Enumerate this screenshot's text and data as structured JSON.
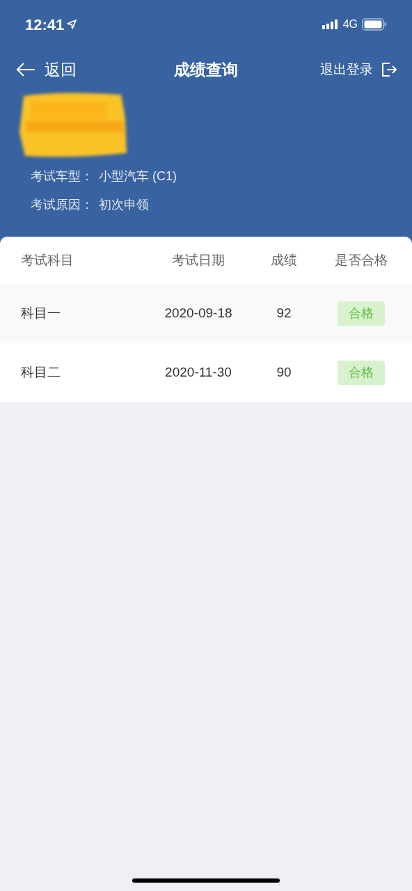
{
  "status_bar": {
    "time": "12:41",
    "network": "4G"
  },
  "nav": {
    "back": "返回",
    "title": "成绩查询",
    "logout": "退出登录"
  },
  "info": [
    {
      "label": "考试车型：",
      "value": "小型汽车 (C1)"
    },
    {
      "label": "考试原因：",
      "value": "初次申领"
    }
  ],
  "table": {
    "columns": [
      "考试科目",
      "考试日期",
      "成绩",
      "是否合格"
    ],
    "rows": [
      {
        "subject": "科目一",
        "date": "2020-09-18",
        "score": "92",
        "result": "合格",
        "passed": true
      },
      {
        "subject": "科目二",
        "date": "2020-11-30",
        "score": "90",
        "result": "合格",
        "passed": true
      }
    ]
  }
}
